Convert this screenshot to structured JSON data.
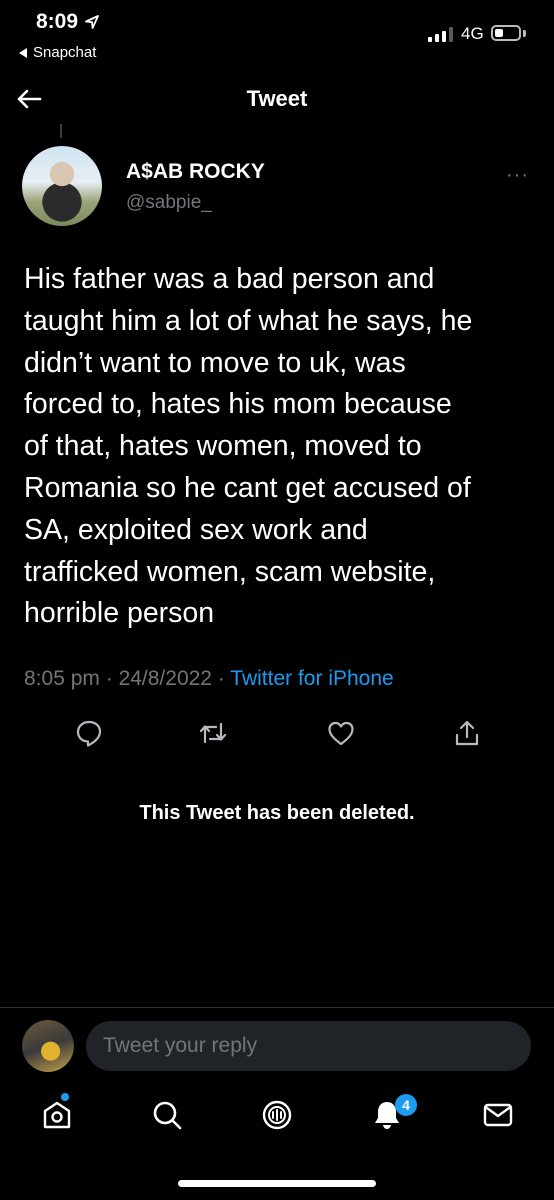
{
  "status_bar": {
    "time": "8:09",
    "back_app": "Snapchat",
    "network": "4G"
  },
  "header": {
    "title": "Tweet"
  },
  "tweet": {
    "display_name": "A$AB ROCKY",
    "handle": "@sabpie_",
    "more": "···",
    "text": "His father was a bad person and\ntaught him a lot of what he says, he\ndidn’t want to move to uk, was\nforced to, hates his mom because\nof that, hates women, moved to\nRomania so he  cant get accused of\nSA, exploited sex work and\ntrafficked women, scam website,\nhorrible person",
    "time": "8:05 pm",
    "date": "24/8/2022",
    "source": "Twitter for iPhone",
    "separator": " · ",
    "actions": [
      "reply-icon",
      "retweet-icon",
      "like-icon",
      "share-icon"
    ]
  },
  "deleted_notice": "This Tweet has been deleted.",
  "reply": {
    "placeholder": "Tweet your reply"
  },
  "tab_bar": {
    "tabs": [
      "home-icon",
      "search-icon",
      "spaces-icon",
      "notifications-icon",
      "messages-icon"
    ],
    "notifications_badge": "4"
  },
  "colors": {
    "background": "#000000",
    "accent": "#1d9bf0",
    "secondary_text": "#71767b"
  }
}
